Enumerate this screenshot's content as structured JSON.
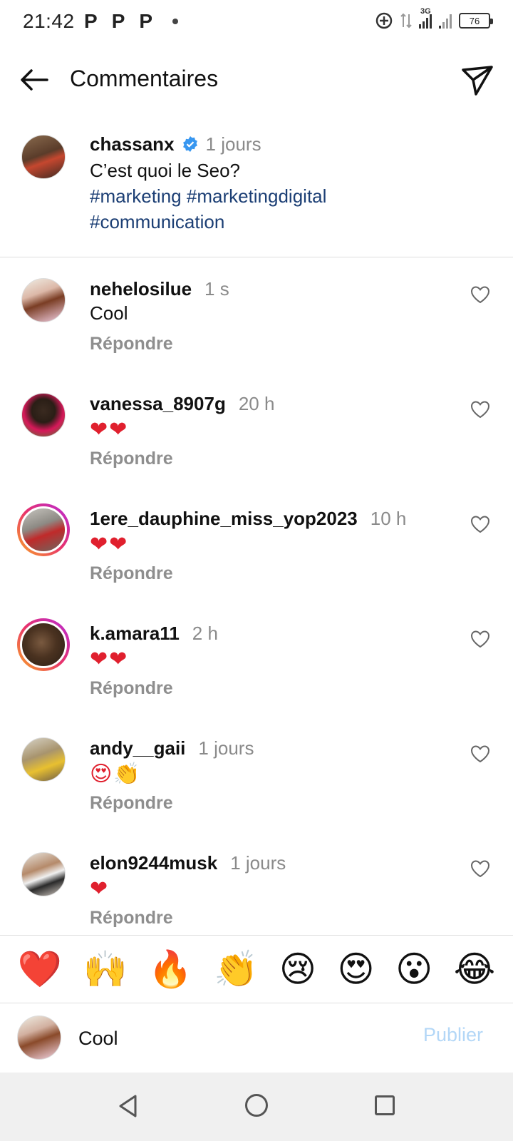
{
  "status_bar": {
    "time": "21:42",
    "notification_icons": [
      "P",
      "P",
      "P"
    ],
    "network": "3G",
    "battery": "76"
  },
  "header": {
    "title": "Commentaires",
    "back_icon": "arrow-left-icon",
    "share_icon": "send-icon"
  },
  "post": {
    "user": "chassanx",
    "verified": true,
    "time": "1 jours",
    "text": "C’est quoi le Seo?",
    "hashtags": [
      "#marketing",
      "#marketingdigital",
      "#communication"
    ]
  },
  "reply_label": "Répondre",
  "comments": [
    {
      "user": "nehelosilue",
      "time": "1 s",
      "text": "Cool",
      "type": "text"
    },
    {
      "user": "vanessa_8907g",
      "time": "20 h",
      "text": "❤❤",
      "type": "emoji"
    },
    {
      "user": "1ere_dauphine_miss_yop2023",
      "time": "10 h",
      "text": "❤❤",
      "type": "emoji",
      "story_ring": true
    },
    {
      "user": "k.amara11",
      "time": "2 h",
      "text": "❤❤",
      "type": "emoji",
      "story_ring": true
    },
    {
      "user": "andy__gaii",
      "time": "1 jours",
      "text": "😍👏",
      "type": "emoji"
    },
    {
      "user": "elon9244musk",
      "time": "1 jours",
      "text": "❤",
      "type": "emoji"
    }
  ],
  "quick_emojis": [
    "❤️",
    "🙌",
    "🔥",
    "👏",
    "😢",
    "😍",
    "😮",
    "😂"
  ],
  "input": {
    "value": "Cool",
    "publish_label": "Publier"
  },
  "colors": {
    "hashtag": "#1b3e74",
    "publish_disabled": "#b3d7f7",
    "verified": "#3897f0"
  }
}
